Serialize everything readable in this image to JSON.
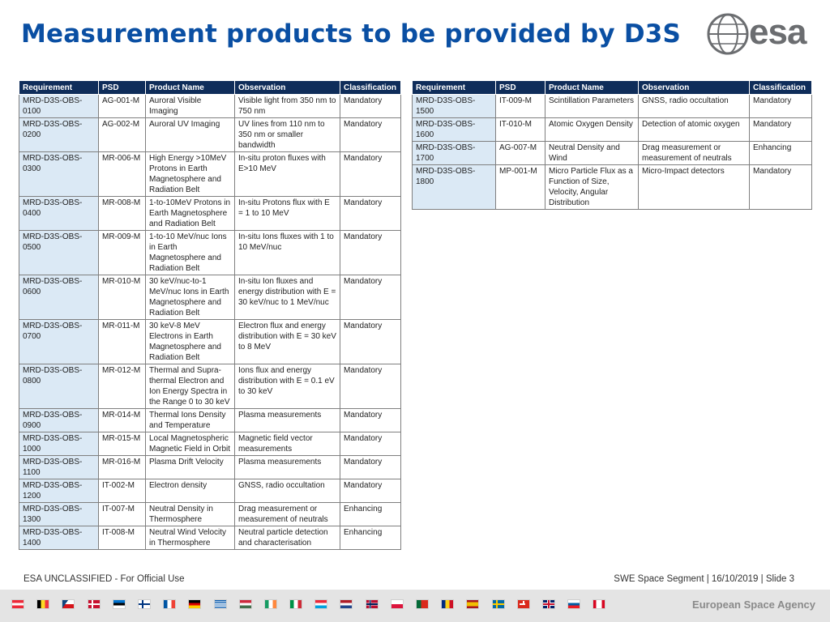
{
  "slide": {
    "title": "Measurement products to be provided by D3S",
    "logo_text": "esa"
  },
  "headers": [
    "Requirement",
    "PSD",
    "Product Name",
    "Observation",
    "Classification"
  ],
  "table_left": [
    [
      "MRD-D3S-OBS-0100",
      "AG-001-M",
      "Auroral Visible Imaging",
      "Visible light from 350 nm to 750 nm",
      "Mandatory"
    ],
    [
      "MRD-D3S-OBS-0200",
      "AG-002-M",
      "Auroral UV Imaging",
      "UV lines from 110 nm to 350 nm or smaller bandwidth",
      "Mandatory"
    ],
    [
      "MRD-D3S-OBS-0300",
      "MR-006-M",
      "High Energy >10MeV Protons in Earth Magnetosphere and Radiation Belt",
      "In-situ proton fluxes with E>10 MeV",
      "Mandatory"
    ],
    [
      "MRD-D3S-OBS-0400",
      "MR-008-M",
      "1-to-10MeV Protons in Earth Magnetosphere and Radiation Belt",
      "In-situ Protons flux with E = 1 to 10 MeV",
      "Mandatory"
    ],
    [
      "MRD-D3S-OBS-0500",
      "MR-009-M",
      "1-to-10 MeV/nuc Ions in Earth Magnetosphere and Radiation Belt",
      "In-situ Ions fluxes with 1 to 10 MeV/nuc",
      "Mandatory"
    ],
    [
      "MRD-D3S-OBS-0600",
      "MR-010-M",
      "30 keV/nuc-to-1 MeV/nuc Ions in Earth Magnetosphere and Radiation Belt",
      "In-situ Ion fluxes and energy distribution with E = 30 keV/nuc to 1 MeV/nuc",
      "Mandatory"
    ],
    [
      "MRD-D3S-OBS-0700",
      "MR-011-M",
      "30 keV-8 MeV Electrons in Earth Magnetosphere and Radiation Belt",
      "Electron flux and energy distribution with E = 30 keV to 8 MeV",
      "Mandatory"
    ],
    [
      "MRD-D3S-OBS-0800",
      "MR-012-M",
      "Thermal and Supra-thermal Electron and Ion Energy Spectra in the Range 0 to 30 keV",
      "Ions flux and energy distribution with E = 0.1 eV to 30 keV",
      "Mandatory"
    ],
    [
      "MRD-D3S-OBS-0900",
      "MR-014-M",
      "Thermal Ions Density and Temperature",
      "Plasma measurements",
      "Mandatory"
    ],
    [
      "MRD-D3S-OBS-1000",
      "MR-015-M",
      "Local Magnetospheric Magnetic Field in Orbit",
      "Magnetic field vector measurements",
      "Mandatory"
    ],
    [
      "MRD-D3S-OBS-1100",
      "MR-016-M",
      "Plasma Drift Velocity",
      "Plasma measurements",
      "Mandatory"
    ],
    [
      "MRD-D3S-OBS-1200",
      "IT-002-M",
      "Electron density",
      "GNSS, radio occultation",
      "Mandatory"
    ],
    [
      "MRD-D3S-OBS-1300",
      "IT-007-M",
      "Neutral Density in Thermosphere",
      "Drag measurement or measurement of neutrals",
      "Enhancing"
    ],
    [
      "MRD-D3S-OBS-1400",
      "IT-008-M",
      "Neutral Wind Velocity in Thermosphere",
      "Neutral particle detection and characterisation",
      "Enhancing"
    ]
  ],
  "table_right": [
    [
      "MRD-D3S-OBS-1500",
      "IT-009-M",
      "Scintillation Parameters",
      "GNSS, radio occultation",
      "Mandatory"
    ],
    [
      "MRD-D3S-OBS-1600",
      "IT-010-M",
      "Atomic Oxygen Density",
      "Detection of atomic oxygen",
      "Mandatory"
    ],
    [
      "MRD-D3S-OBS-1700",
      "AG-007-M",
      "Neutral Density and Wind",
      "Drag measurement or measurement of neutrals",
      "Enhancing"
    ],
    [
      "MRD-D3S-OBS-1800",
      "MP-001-M",
      "Micro Particle Flux as a Function of Size, Velocity, Angular Distribution",
      "Micro-Impact detectors",
      "Mandatory"
    ]
  ],
  "footer": {
    "classification": "ESA UNCLASSIFIED - For Official Use",
    "right": "SWE Space Segment | 16/10/2019 | Slide  3",
    "agency": "European Space Agency"
  },
  "colors": {
    "title": "#0a4fa3",
    "header_bg": "#0f2d5a",
    "req_cell_bg": "#dbe9f5"
  },
  "flags": [
    "austria",
    "belgium",
    "czech-republic",
    "denmark",
    "estonia",
    "finland",
    "france",
    "germany",
    "greece",
    "hungary",
    "ireland",
    "italy",
    "luxembourg",
    "netherlands",
    "norway",
    "poland",
    "portugal",
    "romania",
    "spain",
    "sweden",
    "switzerland",
    "united-kingdom",
    "slovenia",
    "canada"
  ]
}
